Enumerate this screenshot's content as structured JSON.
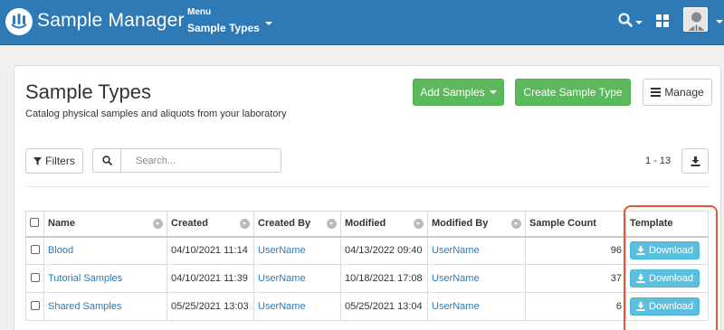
{
  "navbar": {
    "app_title": "Sample Manager",
    "menu_label": "Menu",
    "menu_current": "Sample Types",
    "icons": [
      "logo-icon",
      "search-icon",
      "grid-icon",
      "user-avatar"
    ],
    "brand_color": "#2d7ab7"
  },
  "page": {
    "title": "Sample Types",
    "subtitle": "Catalog physical samples and aliquots from your laboratory"
  },
  "actions": {
    "add_samples": "Add Samples",
    "create_sample_type": "Create Sample Type",
    "manage": "Manage"
  },
  "toolbar": {
    "filters": "Filters",
    "search_placeholder": "Search...",
    "pager": "1 - 13"
  },
  "table": {
    "headers": [
      "Name",
      "Created",
      "Created By",
      "Modified",
      "Modified By",
      "Sample Count",
      "Template"
    ],
    "rows": [
      {
        "name": "Blood",
        "created": "04/10/2021 11:14",
        "created_by": "UserName",
        "modified": "04/13/2022 09:40",
        "modified_by": "UserName",
        "count": "96",
        "template": "Download"
      },
      {
        "name": "Tutorial Samples",
        "created": "04/10/2021 11:39",
        "created_by": "UserName",
        "modified": "10/18/2021 17:08",
        "modified_by": "UserName",
        "count": "37",
        "template": "Download"
      },
      {
        "name": "Shared Samples",
        "created": "05/25/2021 13:03",
        "created_by": "UserName",
        "modified": "05/25/2021 13:04",
        "modified_by": "UserName",
        "count": "6",
        "template": "Download"
      }
    ],
    "highlight_color": "#e05a2b"
  }
}
